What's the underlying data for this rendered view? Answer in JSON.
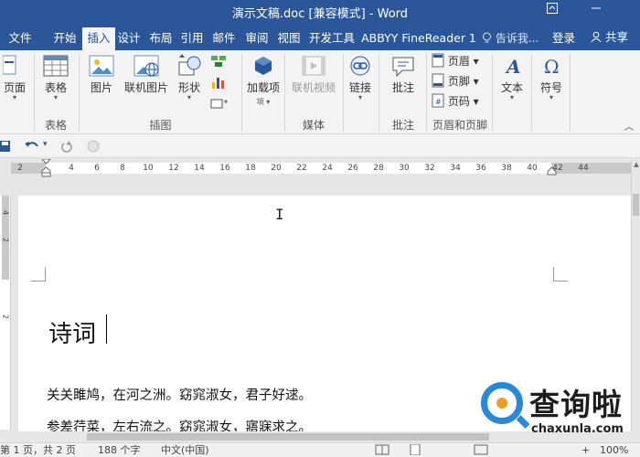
{
  "window": {
    "title": "演示文稿.doc [兼容模式] - Word",
    "restore_icon": "ribbon-display-icon",
    "minimize_icon": "minimize-icon"
  },
  "tabs": [
    "文件",
    "开始",
    "插入",
    "设计",
    "布局",
    "引用",
    "邮件",
    "审阅",
    "视图",
    "开发工具",
    "ABBYY FineReader 1"
  ],
  "active_tab": "插入",
  "tell_me": "告诉我...",
  "login": "登录",
  "share": "共享",
  "ribbon": {
    "pages": "页面",
    "table": "表格",
    "picture": "图片",
    "online_picture": "联机图片",
    "shapes": "形状",
    "addins": "加载项",
    "online_video": "联机视频",
    "link": "链接",
    "comment": "批注",
    "header": "页眉",
    "footer": "页脚",
    "page_number": "页码",
    "text": "文本",
    "symbol": "符号",
    "groups": {
      "table": "表格",
      "illustrations": "插图",
      "media": "媒体",
      "comments": "批注",
      "header_footer": "页眉和页脚"
    }
  },
  "ruler_numbers": [
    "2",
    "2",
    "4",
    "6",
    "8",
    "10",
    "12",
    "14",
    "16",
    "18",
    "20",
    "22",
    "24",
    "26",
    "28",
    "30",
    "32",
    "34",
    "36",
    "38",
    "40",
    "42",
    "44"
  ],
  "vruler_numbers": [
    "4",
    "2",
    "2"
  ],
  "document": {
    "title": "诗词",
    "lines": [
      "关关雎鸠，在河之洲。窈窕淑女，君子好逑。",
      "参差荇菜，左右流之。窈窕淑女，寤寐求之。"
    ]
  },
  "status": {
    "page": "第 1 页，共 2 页",
    "words": "188 个字",
    "lang": "中文(中国)",
    "zoom": "100%"
  },
  "watermark": {
    "cn": "查询啦",
    "en": "chaxunla.com"
  },
  "colors": {
    "brand": "#2b579a",
    "watermark_blue": "#2a88d9",
    "watermark_orange": "#f29b24"
  }
}
